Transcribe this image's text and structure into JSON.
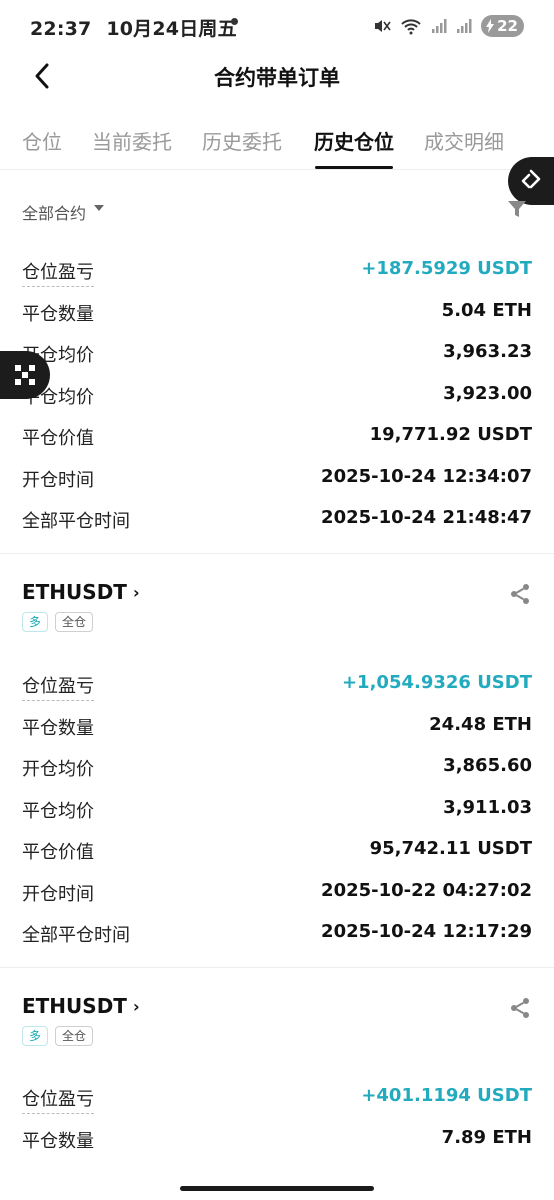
{
  "status_bar": {
    "time": "22:37",
    "date": "10月24日周五",
    "battery": "22"
  },
  "header": {
    "title": "合约带单订单"
  },
  "tabs": [
    {
      "label": "仓位"
    },
    {
      "label": "当前委托"
    },
    {
      "label": "历史委托"
    },
    {
      "label": "历史仓位"
    },
    {
      "label": "成交明细"
    }
  ],
  "filter": {
    "label": "全部合约"
  },
  "positions": [
    {
      "rows": [
        {
          "label": "仓位盈亏",
          "value": "+187.5929 USDT"
        },
        {
          "label": "平仓数量",
          "value": "5.04 ETH"
        },
        {
          "label": "开仓均价",
          "value": "3,963.23"
        },
        {
          "label": "平仓均价",
          "value": "3,923.00"
        },
        {
          "label": "平仓价值",
          "value": "19,771.92 USDT"
        },
        {
          "label": "开仓时间",
          "value": "2025-10-24 12:34:07"
        },
        {
          "label": "全部平仓时间",
          "value": "2025-10-24 21:48:47"
        }
      ]
    },
    {
      "symbol": "ETHUSDT",
      "tags": [
        "多",
        "全仓"
      ],
      "rows": [
        {
          "label": "仓位盈亏",
          "value": "+1,054.9326 USDT"
        },
        {
          "label": "平仓数量",
          "value": "24.48 ETH"
        },
        {
          "label": "开仓均价",
          "value": "3,865.60"
        },
        {
          "label": "平仓均价",
          "value": "3,911.03"
        },
        {
          "label": "平仓价值",
          "value": "95,742.11 USDT"
        },
        {
          "label": "开仓时间",
          "value": "2025-10-22 04:27:02"
        },
        {
          "label": "全部平仓时间",
          "value": "2025-10-24 12:17:29"
        }
      ]
    },
    {
      "symbol": "ETHUSDT",
      "tags": [
        "多",
        "全仓"
      ],
      "rows": [
        {
          "label": "仓位盈亏",
          "value": "+401.1194 USDT"
        },
        {
          "label": "平仓数量",
          "value": "7.89 ETH"
        }
      ]
    }
  ],
  "colors": {
    "profit": "#22aabf",
    "long_tag": "#1aa9b6"
  }
}
